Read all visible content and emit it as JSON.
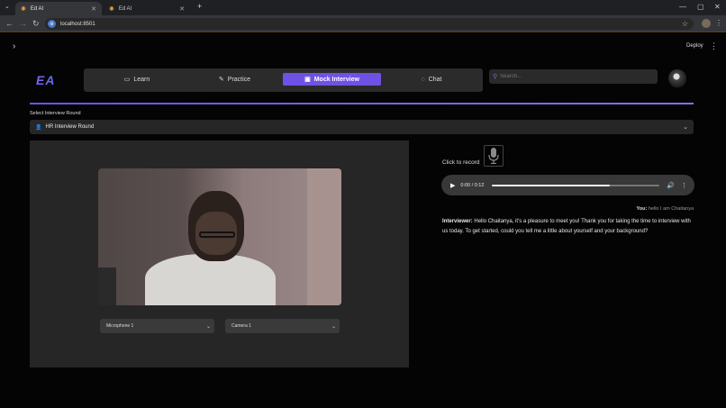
{
  "browser": {
    "tabs": [
      {
        "title": "Ed AI",
        "active": true
      },
      {
        "title": "Ed AI",
        "active": false
      }
    ],
    "new_tab": "+",
    "url": "localhost:8501",
    "controls": {
      "minimize": "—",
      "maximize": "▢",
      "close": "✕"
    }
  },
  "app": {
    "logo": "EA",
    "deploy_label": "Deploy",
    "nav": [
      {
        "label": "Learn",
        "icon": "book-icon"
      },
      {
        "label": "Practice",
        "icon": "pencil-icon"
      },
      {
        "label": "Mock Interview",
        "icon": "briefcase-icon",
        "active": true
      },
      {
        "label": "Chat",
        "icon": "chat-icon"
      }
    ],
    "search_placeholder": "Search...",
    "round_label": "Select Interview Round",
    "round_value": "HR Interview Round",
    "microphone": "Microphone 1",
    "camera": "Camera 1",
    "record_label": "Click to record",
    "audio": {
      "time": "0:00 / 0:12",
      "progress": 0.7
    },
    "you_label": "You:",
    "you_text": "hello I am Chaitanya",
    "interviewer_label": "Interviewer:",
    "interviewer_text": "Hello Chaitanya, it's a pleasure to meet you! Thank you for taking the time to interview with us today. To get started, could you tell me a little about yourself and your background?"
  },
  "colors": {
    "accent": "#6e52e6",
    "panel": "#262626",
    "background": "#040404"
  }
}
